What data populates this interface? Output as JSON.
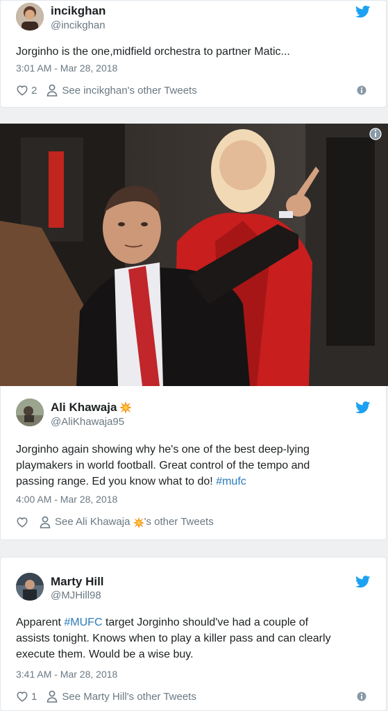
{
  "tweets": [
    {
      "name": "incikghan",
      "handle": "@incikghan",
      "text": "Jorginho is the one,midfield orchestra to partner Matic...",
      "time": "3:01 AM - Mar 28, 2018",
      "likes": "2",
      "see_other": "See incikghan's other Tweets"
    },
    {
      "name": "Ali Khawaja",
      "handle": "@AliKhawaja95",
      "text_lines": [
        "Jorginho again showing why he's one of the best deep-lying",
        "playmakers in world football. Great control of the tempo and",
        "passing range. Ed you know what to do! "
      ],
      "hashtag": "#mufc",
      "time": "4:00 AM - Mar 28, 2018",
      "likes": "",
      "see_other_prefix": "See Ali Khawaja ",
      "see_other_suffix": "'s other Tweets"
    },
    {
      "name": "Marty Hill",
      "handle": "@MJHill98",
      "text_prefix": "Apparent ",
      "hashtag": "#MUFC",
      "text_rest": " target Jorginho should've had a couple of",
      "text_line2": "assists tonight. Knows when to play a killer pass and can clearly",
      "text_line3": "execute them. Would be a wise buy.",
      "time": "3:41 AM - Mar 28, 2018",
      "likes": "1",
      "see_other": "See Marty Hill's other Tweets"
    }
  ],
  "icons": {
    "bird": "twitter-bird-icon",
    "heart": "heart-icon",
    "person": "person-icon",
    "info": "info-icon",
    "burst": "explosion-emoji-icon"
  },
  "colors": {
    "twitter_blue": "#1da1f2",
    "hashtag": "#2b7bb9",
    "meta_gray": "#697882"
  }
}
